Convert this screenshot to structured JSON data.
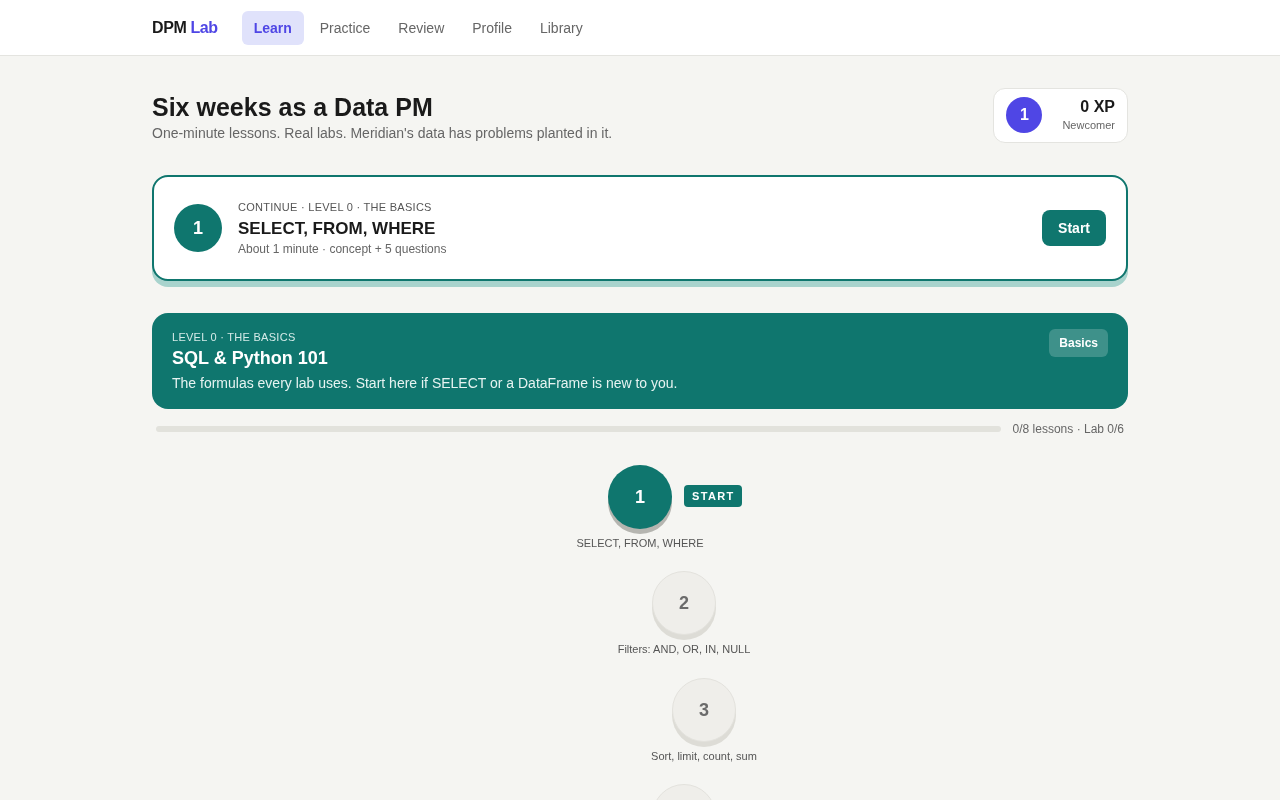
{
  "brand": {
    "name": "DPM",
    "accent": "Lab"
  },
  "nav": [
    {
      "label": "Learn",
      "selected": true
    },
    {
      "label": "Practice",
      "selected": false
    },
    {
      "label": "Review",
      "selected": false
    },
    {
      "label": "Profile",
      "selected": false
    },
    {
      "label": "Library",
      "selected": false
    }
  ],
  "header": {
    "title": "Six weeks as a Data PM",
    "subtitle": "One-minute lessons. Real labs. Meridian's data has problems planted in it."
  },
  "xp_card": {
    "level": "1",
    "xp": "0 XP",
    "rank": "Newcomer"
  },
  "continue_card": {
    "number": "1",
    "eyebrow": "CONTINUE · LEVEL 0 · THE BASICS",
    "title": "SELECT, FROM, WHERE",
    "meta": "About 1 minute · concept + 5 questions",
    "button": "Start"
  },
  "unit": {
    "eyebrow": "LEVEL 0 · THE BASICS",
    "title": "SQL & Python 101",
    "description": "The formulas every lab uses. Start here if SELECT or a DataFrame is new to you.",
    "tag": "Basics",
    "progress": {
      "level": 0,
      "reading": "0/8 lessons · Lab 0/6"
    }
  },
  "path": [
    {
      "number": "1",
      "label": "SELECT, FROM, WHERE",
      "current": true,
      "badge": "START"
    },
    {
      "number": "2",
      "label": "Filters: AND, OR, IN, NULL",
      "current": false
    },
    {
      "number": "3",
      "label": "Sort, limit, count, sum",
      "current": false
    },
    {
      "current": false
    }
  ]
}
